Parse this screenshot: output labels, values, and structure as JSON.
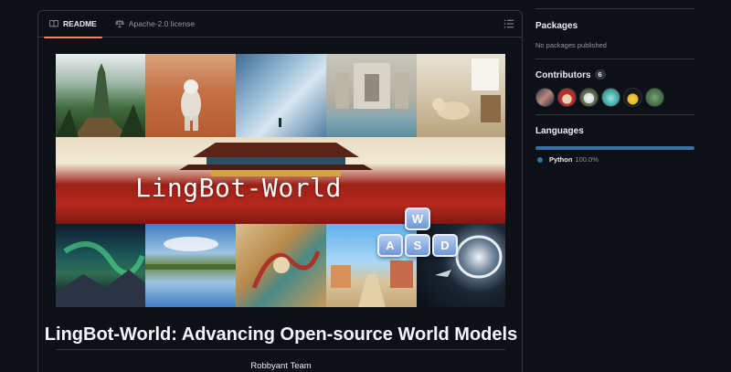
{
  "readme": {
    "tabs": [
      {
        "label": "README",
        "icon": "book-icon",
        "active": true
      },
      {
        "label": "Apache-2.0 license",
        "icon": "law-scale-icon",
        "active": false
      }
    ],
    "toc_icon": "list-unordered-icon",
    "banner": {
      "title_text": "LingBot-World",
      "keys": [
        "W",
        "A",
        "S",
        "D"
      ],
      "scenes_top": [
        "fantasy-jungle-temple",
        "astronaut-on-mars",
        "frozen-ice-landscape",
        "trevi-fountain",
        "dog-in-living-room"
      ],
      "scenes_bottom": [
        "aurora-night-sky",
        "lake-reflection",
        "chinese-mural-painting",
        "anime-village-street",
        "spaceship-wormhole"
      ]
    },
    "heading": "LingBot-World: Advancing Open-source World Models",
    "author": "Robbyant Team"
  },
  "sidebar": {
    "packages": {
      "heading": "Packages",
      "empty_text": "No packages published"
    },
    "contributors": {
      "heading": "Contributors",
      "count": "6",
      "avatars": 6
    },
    "languages": {
      "heading": "Languages",
      "items": [
        {
          "name": "Python",
          "percent": "100.0%",
          "color": "#3572a5",
          "share": 1.0
        }
      ]
    }
  },
  "colors": {
    "background": "#0d1117",
    "border": "#30363d",
    "tab_underline": "#f78166",
    "muted_text": "#9198a1"
  }
}
